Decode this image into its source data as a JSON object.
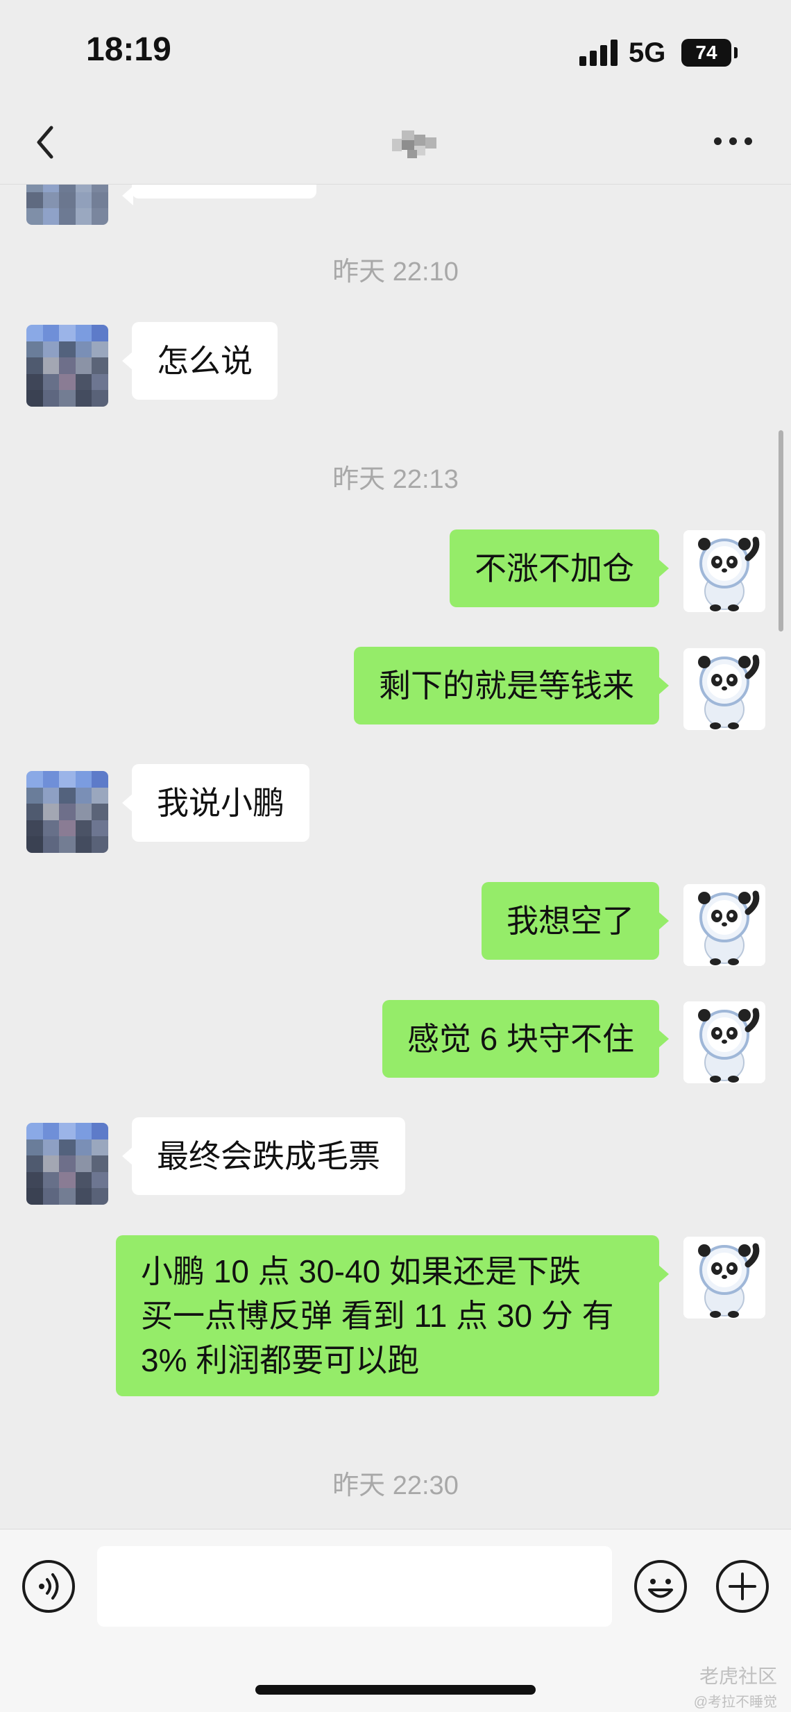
{
  "status_bar": {
    "time": "18:19",
    "network": "5G",
    "battery": "74",
    "icons": [
      "signal-bars-icon",
      "battery-icon"
    ]
  },
  "nav": {
    "back_icon": "chevron-left-icon",
    "title": "",
    "more_icon": "ellipsis-icon"
  },
  "messages": [
    {
      "type": "timestamp",
      "text": "昨天 22:10"
    },
    {
      "type": "incoming",
      "text": "怎么说"
    },
    {
      "type": "timestamp",
      "text": "昨天 22:13"
    },
    {
      "type": "outgoing",
      "text": "不涨不加仓"
    },
    {
      "type": "outgoing",
      "text": "剩下的就是等钱来"
    },
    {
      "type": "incoming",
      "text": "我说小鹏"
    },
    {
      "type": "outgoing",
      "text": "我想空了"
    },
    {
      "type": "outgoing",
      "text": "感觉 6 块守不住"
    },
    {
      "type": "incoming",
      "text": "最终会跌成毛票"
    },
    {
      "type": "outgoing",
      "lines": [
        "小鹏 10 点 30-40 如果还是下跌",
        "买一点博反弹 看到 11 点 30 分 有",
        "3% 利润都要可以跑"
      ]
    },
    {
      "type": "timestamp",
      "text": "昨天 22:30"
    }
  ],
  "input_bar": {
    "voice_icon": "voice-icon",
    "input_value": "",
    "emoji_icon": "emoji-icon",
    "plus_icon": "plus-icon"
  },
  "watermark": {
    "main": "老虎社区",
    "sub": "@考拉不睡觉"
  },
  "colors": {
    "background": "#ededed",
    "outgoing_bubble": "#95ec69",
    "incoming_bubble": "#ffffff",
    "timestamp_text": "#a8a8a8"
  }
}
